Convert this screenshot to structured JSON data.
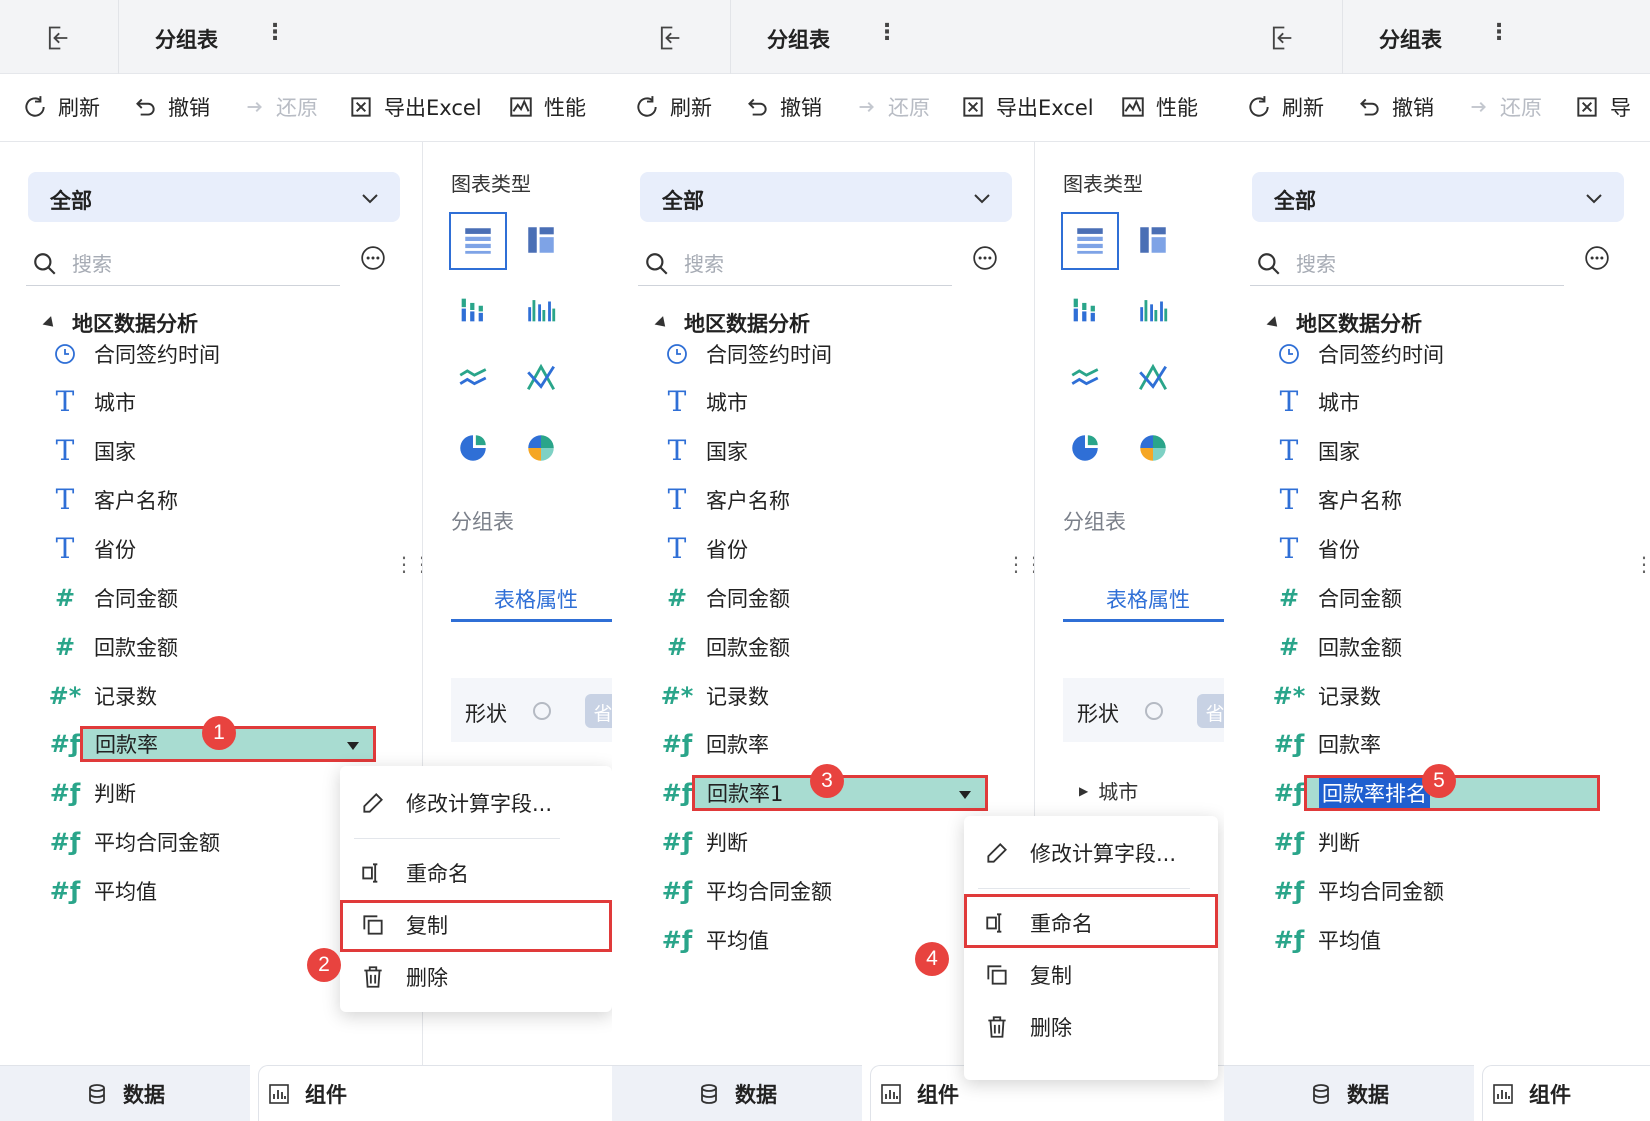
{
  "header": {
    "title": "分组表",
    "more": "⋮"
  },
  "toolbar": {
    "refresh": "刷新",
    "undo": "撤销",
    "redo": "还原",
    "export": "导出Excel",
    "perf": "性能",
    "export_short": "导"
  },
  "dataset": {
    "selected": "全部",
    "search_placeholder": "搜索",
    "root": "地区数据分析",
    "fields": [
      "合同签约时间",
      "城市",
      "国家",
      "客户名称",
      "省份",
      "合同金额",
      "回款金额",
      "记录数",
      "回款率"
    ],
    "extra_fields_p1": [
      "判断",
      "平均合同金额",
      "平均值"
    ]
  },
  "panel2": {
    "copy_field": "回款率1"
  },
  "panel3": {
    "renamed_field": "回款率排名"
  },
  "chart": {
    "title": "图表类型",
    "current": "分组表",
    "prop_tab": "表格属性",
    "shape_label": "形状",
    "shape_tag": "省",
    "city_item": "城市"
  },
  "menu": {
    "edit": "修改计算字段...",
    "rename": "重命名",
    "copy": "复制",
    "delete": "删除"
  },
  "bottom": {
    "data_tab": "数据",
    "comp_tab": "组件"
  },
  "steps": [
    "1",
    "2",
    "3",
    "4",
    "5"
  ],
  "colors": {
    "accent": "#2f6fd6",
    "highlight": "#a8dcd1",
    "annotation": "#e03a3a",
    "measure": "#2aa58a"
  }
}
